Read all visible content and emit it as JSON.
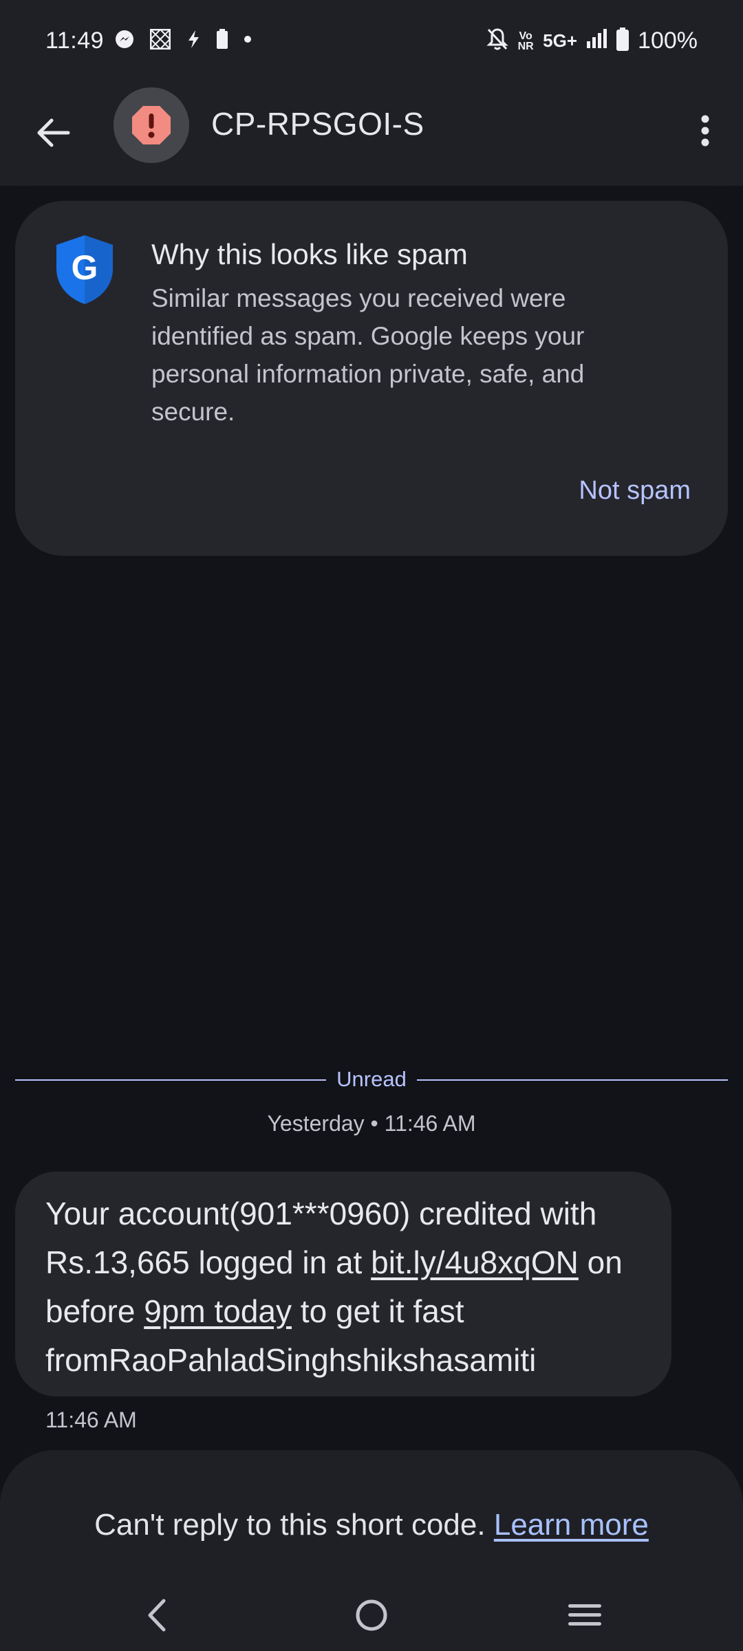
{
  "status_bar": {
    "time": "11:49",
    "network": "5G+",
    "volte": "Vo NR",
    "battery": "100%",
    "left_icons": [
      "messenger-icon",
      "qr-grid-icon",
      "charging-bolt-icon",
      "battery-small-icon",
      "dot-icon"
    ],
    "right_icons": [
      "muted-bell-icon",
      "volte-icon",
      "signal-icon",
      "battery-icon"
    ]
  },
  "app_bar": {
    "contact_name": "CP-RPSGOI-S",
    "avatar_icon": "spam-alert-icon",
    "avatar_color": "#f28b82"
  },
  "spam_card": {
    "title": "Why this looks like spam",
    "body": "Similar messages you received were identified as spam. Google keeps your personal information private, safe, and secure.",
    "action": "Not spam",
    "shield_color": "#1a73e8"
  },
  "conversation": {
    "unread_label": "Unread",
    "date_label": "Yesterday • 11:46 AM",
    "message": {
      "text_1": "Your account(901***0960) credited with Rs.13,665 logged in at ",
      "link": "bit.ly/4u8xqON",
      "text_2": " on before ",
      "time_link": "9pm today",
      "text_3": " to get it fast fromRaoPahladSinghshikshasamiti",
      "time": "11:46 AM"
    }
  },
  "notice": {
    "text": "Can't reply to this short code.",
    "link": "Learn more"
  },
  "colors": {
    "accent": "#b7c3ff",
    "link": "#a8c1ff",
    "surface": "#25262c",
    "background": "#121318"
  }
}
